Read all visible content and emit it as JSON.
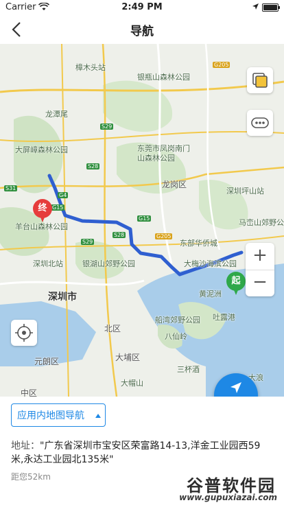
{
  "status_bar": {
    "carrier": "Carrier",
    "time": "2:49 PM"
  },
  "nav": {
    "title": "导航"
  },
  "map": {
    "labels": {
      "zhangmutou": "樟木头站",
      "yinping": "银瓶山森林公园",
      "longtan": "龙潭尾",
      "dapingzhang": "大屏嶂森林公园",
      "dongguan_fhg": "东莞市凤岗南门",
      "senlin_park": "山森林公园",
      "longgang": "龙岗区",
      "shenzhen_pingshan": "深圳坪山站",
      "ma_luan": "马峦山郊野公",
      "yangtaishan": "羊台山森林公园",
      "dongbu_huaqiao": "东部华侨城",
      "shenzhen_north": "深圳北站",
      "yinhu": "银湖山郊野公园",
      "dameisha": "大梅沙海滨公园",
      "shenzhen_city": "深圳市",
      "huangkou": "黄泥洲",
      "chuanwan": "船湾郊野公园",
      "tongwan": "吐露港",
      "baxian": "八仙岭",
      "beiqu": "北区",
      "dapu": "大埔区",
      "yuanlang": "元朗区",
      "damaoshan": "大帽山",
      "sanmen": "三杯酒",
      "dalang": "大浪",
      "zhongqu": "中区"
    },
    "roads": [
      "G205",
      "S29",
      "S28",
      "G15",
      "S31",
      "G4",
      "G15",
      "S28",
      "S29",
      "G205"
    ],
    "end_marker": "终",
    "start_marker": "起",
    "zoom_in": "+",
    "zoom_out": "−"
  },
  "nav_button": {
    "label": "导航"
  },
  "bottom": {
    "app_select": "应用内地图导航",
    "address_key": "地址：",
    "address_value": "\"广东省深圳市宝安区荣富路14-13,洋金工业园西59米,永达工业园北135米\"",
    "distance": "距您52km"
  },
  "watermark": {
    "line1": "谷普软件园",
    "line2": "www.gupuxiazai.com"
  },
  "colors": {
    "accent": "#1e88e5",
    "route": "#2f5fd0",
    "start": "#2fa84a",
    "end": "#e63c3c"
  }
}
